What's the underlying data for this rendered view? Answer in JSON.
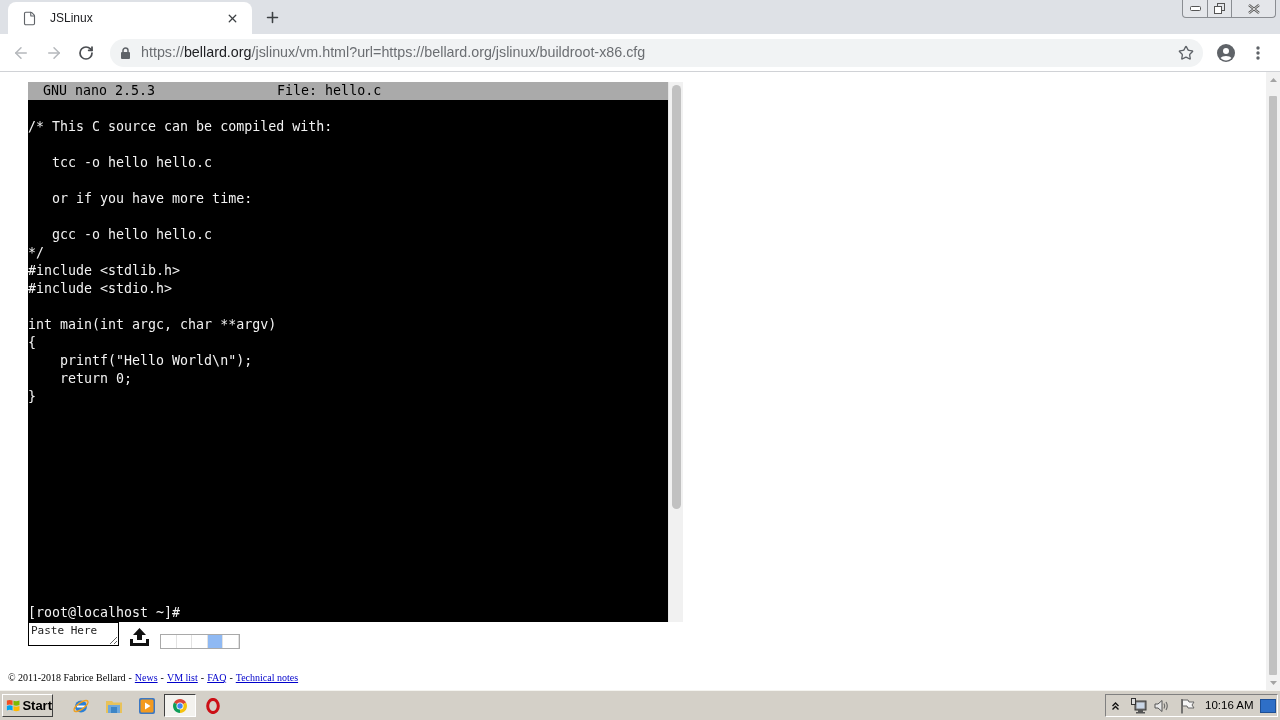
{
  "browser": {
    "tabs": [
      {
        "title": "JSLinux",
        "selected": true
      }
    ],
    "address_bar": {
      "scheme": "https://",
      "host": "bellard.org",
      "path": "/jslinux/vm.html?url=https://bellard.org/jslinux/buildroot-x86.cfg"
    }
  },
  "terminal": {
    "header": {
      "program": "GNU nano 2.5.3",
      "file": "File: hello.c"
    },
    "blocks": [
      {
        "lines": [
          "/* This C source can be compiled with:"
        ]
      },
      {
        "lines": [
          "   tcc -o hello hello.c"
        ]
      },
      {
        "lines": [
          "   or if you have more time:"
        ]
      },
      {
        "lines": [
          "   gcc -o hello hello.c",
          "*/",
          "#include <stdlib.h>",
          "#include <stdio.h>"
        ]
      },
      {
        "lines": [
          "int main(int argc, char **argv)",
          "{",
          "    printf(\"Hello World\\n\");",
          "    return 0;",
          "}"
        ]
      }
    ],
    "prompt": "[root@localhost ~]#"
  },
  "controls": {
    "paste_field": {
      "placeholder": "Paste Here"
    },
    "activity_cells": [
      {
        "on": false
      },
      {
        "on": false
      },
      {
        "on": false
      },
      {
        "on": true
      },
      {
        "on": false
      }
    ]
  },
  "footer": {
    "parts": [
      {
        "kind": "text",
        "text": "© 2011-2018 Fabrice Bellard"
      },
      {
        "kind": "text",
        "text": "-"
      },
      {
        "kind": "link",
        "text": "News"
      },
      {
        "kind": "text",
        "text": "-"
      },
      {
        "kind": "link",
        "text": "VM list"
      },
      {
        "kind": "text",
        "text": "-"
      },
      {
        "kind": "link",
        "text": "FAQ"
      },
      {
        "kind": "text",
        "text": "-"
      },
      {
        "kind": "link",
        "text": "Technical notes"
      }
    ]
  },
  "taskbar": {
    "start": "Start",
    "apps": [
      {
        "selected": false
      },
      {
        "selected": false
      },
      {
        "selected": false
      },
      {
        "selected": true
      },
      {
        "selected": false
      }
    ],
    "clock": "10:16 AM"
  }
}
